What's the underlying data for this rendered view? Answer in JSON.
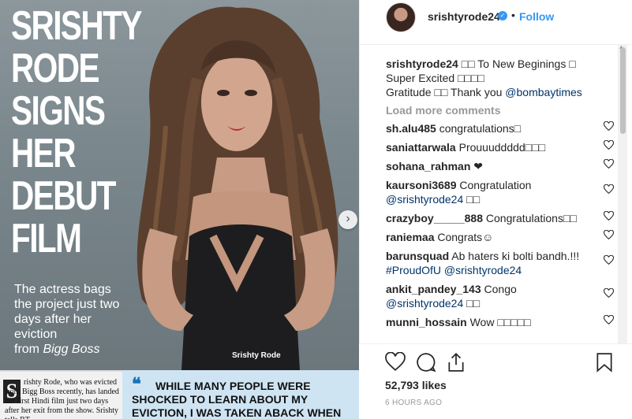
{
  "post_image": {
    "headline": [
      "SRISHTY",
      "RODE",
      "SIGNS",
      "HER",
      "DEBUT",
      "FILM"
    ],
    "subhead_lines": [
      "The actress bags",
      "the project just two",
      "days after her",
      "eviction"
    ],
    "subhead_show_prefix": "from ",
    "subhead_show": "Bigg Boss",
    "photo_credit": "Srishty Rode",
    "news_left_drop": "S",
    "news_left_text": "rishty Rode, who was evicted from Bigg Boss recently, has landed her first Hindi film just two days after her exit from the show. Srishty tells BT,",
    "news_right_text": "WHILE MANY PEOPLE WERE SHOCKED TO LEARN ABOUT MY EVICTION, I WAS TAKEN ABACK WHEN THE MAKERS OF THE"
  },
  "header": {
    "username": "srishtyrode24",
    "separator": "•",
    "follow_label": "Follow"
  },
  "caption": {
    "user": "srishtyrode24",
    "line1": "□□ To New Beginings □",
    "line2": "Super Excited □□□□",
    "line3_text": "Gratitude □□ Thank you ",
    "line3_mention": "@bombaytimes"
  },
  "load_more_label": "Load more comments",
  "comments": [
    {
      "user": "sh.alu485",
      "text": " congratulations□"
    },
    {
      "user": "saniattarwala",
      "text": " Prouuuddddd□□□"
    },
    {
      "user": "sohana_rahman",
      "text": " ❤"
    },
    {
      "user": "kaursoni3689",
      "text": " Congratulation",
      "mention": "@srishtyrode24",
      "after": " □□"
    },
    {
      "user": "crazyboy_____888",
      "text": " Congratulations□□"
    },
    {
      "user": "raniemaa",
      "text": " Congrats☺"
    },
    {
      "user": "barunsquad",
      "text": " Ab haters ki bolti bandh.!!! ",
      "hashtag": "#ProudOfU",
      "mention": " @srishtyrode24"
    },
    {
      "user": "ankit_pandey_143",
      "text": " Congo",
      "mention": "@srishtyrode24",
      "after": " □□"
    },
    {
      "user": "munni_hossain",
      "text": " Wow □□□□□"
    }
  ],
  "likes": "52,793 likes",
  "time": "6 HOURS AGO",
  "icons": {
    "like": "heart-icon",
    "comment": "comment-icon",
    "share": "share-icon",
    "save": "bookmark-icon",
    "verified": "verified-badge-icon",
    "next": "chevron-right-icon"
  },
  "colors": {
    "link_blue": "#3897f0",
    "mention_blue": "#003569",
    "muted": "#999999",
    "text": "#262626"
  }
}
